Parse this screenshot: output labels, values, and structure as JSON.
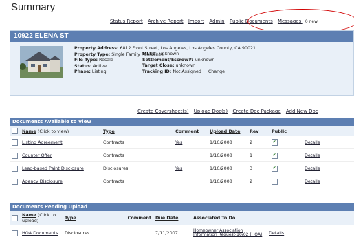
{
  "page_title": "Summary",
  "top_nav": {
    "links": [
      "Status Report",
      "Archive Report",
      "Import",
      "Admin",
      "Public Documents",
      "Messages:"
    ],
    "messages_count": "0 new"
  },
  "property": {
    "address_title": "10922 ELENA ST",
    "property_address_label": "Property Address:",
    "property_address": "6812 Front Street, Los Angeles, Los Angeles County, CA 90021",
    "property_type_label": "Property Type:",
    "property_type": "Single Family Residence",
    "file_type_label": "File Type:",
    "file_type": "Resale",
    "status_label": "Status:",
    "status": "Active",
    "phase_label": "Phase:",
    "phase": "Listing",
    "mls_label": "MLS#:",
    "mls": "unknown",
    "settlement_label": "Settlement/Escrow#:",
    "settlement": "unknown",
    "target_close_label": "Target Close:",
    "target_close": "unknown",
    "tracking_label": "Tracking ID:",
    "tracking": "Not Assigned",
    "change_label": "Change"
  },
  "actions": [
    "Create Coversheet(s)",
    "Upload Doc(s)",
    "Create Doc Package",
    "Add New Doc"
  ],
  "available": {
    "title": "Documents Available to View",
    "headers": {
      "name": "Name",
      "name_hint": "(Click to view)",
      "type": "Type",
      "comment": "Comment",
      "upload_date": "Upload Date",
      "rev": "Rev",
      "public": "Public"
    },
    "rows": [
      {
        "name": "Listing Agreement",
        "type": "Contracts",
        "comment": "Yes",
        "date": "1/16/2008",
        "rev": "2",
        "public": true,
        "details": "Details"
      },
      {
        "name": "Counter Offer",
        "type": "Contracts",
        "comment": "",
        "date": "1/16/2008",
        "rev": "1",
        "public": true,
        "details": "Details"
      },
      {
        "name": "Lead-based Paint Disclosure",
        "type": "Disclosures",
        "comment": "Yes",
        "date": "1/16/2008",
        "rev": "3",
        "public": true,
        "details": "Details"
      },
      {
        "name": "Agency Disclosure",
        "type": "Contracts",
        "comment": "",
        "date": "1/16/2008",
        "rev": "2",
        "public": false,
        "details": "Details"
      }
    ]
  },
  "pending": {
    "title": "Documents Pending Upload",
    "headers": {
      "name": "Name",
      "name_hint": "(Click to upload)",
      "type": "Type",
      "comment": "Comment",
      "due_date": "Due Date",
      "associated": "Associated To Do"
    },
    "rows": [
      {
        "name": "HOA Documents",
        "type": "Disclosures",
        "comment": "",
        "due": "7/11/2007",
        "associated": "Homeowner Association Information Request-10/02 (HOA)",
        "details": "Details"
      }
    ]
  }
}
